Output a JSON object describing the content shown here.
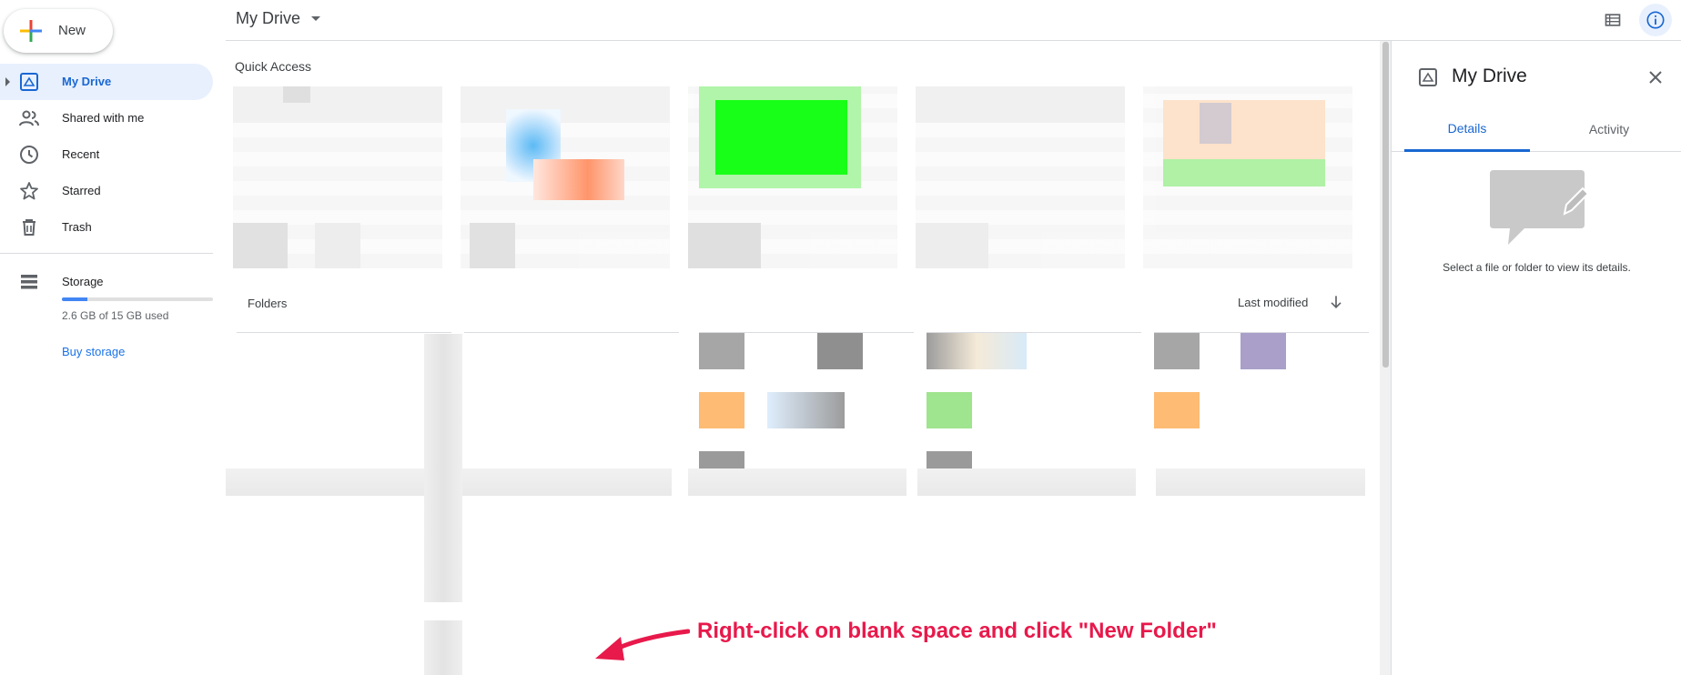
{
  "sidebar": {
    "new_label": "New",
    "items": [
      {
        "label": "My Drive",
        "icon": "my-drive-icon",
        "active": true
      },
      {
        "label": "Shared with me",
        "icon": "people-icon"
      },
      {
        "label": "Recent",
        "icon": "clock-icon"
      },
      {
        "label": "Starred",
        "icon": "star-icon"
      },
      {
        "label": "Trash",
        "icon": "trash-icon"
      }
    ],
    "storage": {
      "label": "Storage",
      "used_text": "2.6 GB of 15 GB used",
      "used_fraction": 0.17,
      "buy_label": "Buy storage"
    }
  },
  "header": {
    "title": "My Drive"
  },
  "main": {
    "quick_access_title": "Quick Access",
    "folders_title": "Folders",
    "sort_label": "Last modified"
  },
  "details_panel": {
    "title": "My Drive",
    "tabs": [
      {
        "label": "Details",
        "active": true
      },
      {
        "label": "Activity"
      }
    ],
    "hint": "Select a file or folder to view its details."
  },
  "annotation": {
    "text": "Right-click on blank space and click \"New Folder\""
  },
  "colors": {
    "accent": "#1967d2",
    "active_bg": "#e8f0fe",
    "annotation": "#e8194b",
    "divider": "#dadce0"
  }
}
